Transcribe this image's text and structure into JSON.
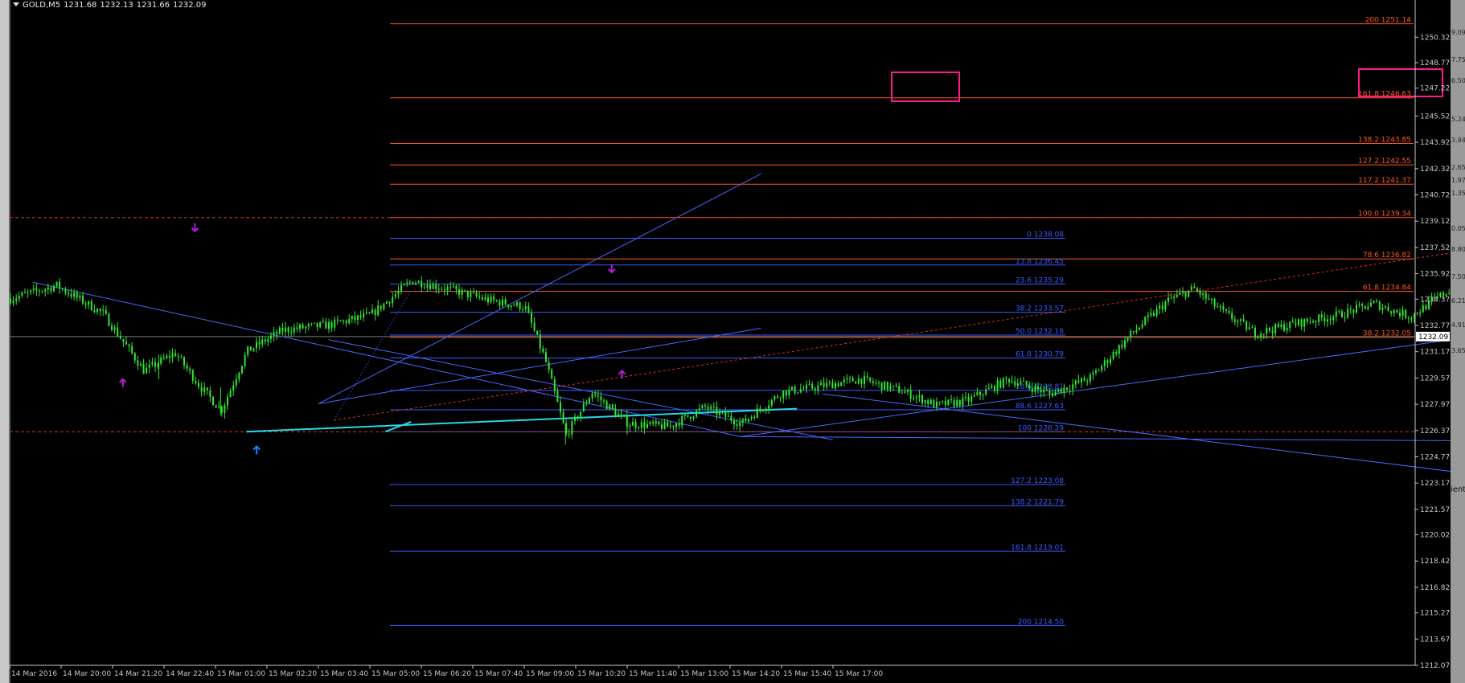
{
  "header": {
    "symbol": "GOLD,M5",
    "open": "1231.68",
    "high": "1232.13",
    "low": "1231.66",
    "close": "1232.09"
  },
  "colors": {
    "background": "#000000",
    "candle": "#2fe82f",
    "fib_red": "#ff5a1f",
    "fib_blue": "#3a5bff",
    "trend_blue": "#4868ff",
    "support_cyan": "#28d8e8",
    "dashed_red": "#e03020",
    "arrow_purple": "#b020e0",
    "arrow_blue": "#2080ff",
    "highlight_magenta": "#ff1a8c",
    "axis_text": "#c8c8c8"
  },
  "chart_data": {
    "type": "candlestick",
    "title": "GOLD,M5",
    "timeframe": "M5",
    "ylim": [
      1212.07,
      1252.0
    ],
    "price_ticks": [
      "1250.32",
      "1248.77",
      "1247.22",
      "1245.52",
      "1243.92",
      "1242.32",
      "1240.72",
      "1239.12",
      "1237.52",
      "1235.92",
      "1234.37",
      "1232.77",
      "1231.17",
      "1229.57",
      "1227.97",
      "1226.37",
      "1224.77",
      "1223.17",
      "1221.57",
      "1220.02",
      "1218.42",
      "1216.82",
      "1215.27",
      "1213.67",
      "1212.07"
    ],
    "time_ticks": [
      "14 Mar 2016",
      "14 Mar 20:00",
      "14 Mar 21:20",
      "14 Mar 22:40",
      "15 Mar 01:00",
      "15 Mar 02:20",
      "15 Mar 03:40",
      "15 Mar 05:00",
      "15 Mar 06:20",
      "15 Mar 07:40",
      "15 Mar 09:00",
      "15 Mar 10:20",
      "15 Mar 11:40",
      "15 Mar 13:00",
      "15 Mar 14:20",
      "15 Mar 15:40",
      "15 Mar 17:00"
    ],
    "current_price": "1232.09",
    "price_anchors": [
      [
        0,
        1234.4
      ],
      [
        0.9,
        1235.2
      ],
      [
        1.8,
        1233.5
      ],
      [
        2.6,
        1230.0
      ],
      [
        3.2,
        1231.1
      ],
      [
        3.7,
        1229.0
      ],
      [
        4.1,
        1227.6
      ],
      [
        4.6,
        1231.2
      ],
      [
        5.3,
        1232.5
      ],
      [
        6.2,
        1232.8
      ],
      [
        7.0,
        1233.4
      ],
      [
        7.8,
        1235.5
      ],
      [
        8.5,
        1235.0
      ],
      [
        9.3,
        1234.3
      ],
      [
        10.0,
        1233.9
      ],
      [
        10.4,
        1230.6
      ],
      [
        10.8,
        1226.1
      ],
      [
        11.3,
        1228.7
      ],
      [
        12.0,
        1226.8
      ],
      [
        12.8,
        1226.6
      ],
      [
        13.5,
        1227.8
      ],
      [
        14.2,
        1226.8
      ],
      [
        15.0,
        1228.7
      ],
      [
        15.8,
        1229.1
      ],
      [
        16.5,
        1229.5
      ],
      [
        17.3,
        1228.8
      ],
      [
        18.0,
        1227.9
      ],
      [
        18.6,
        1228.2
      ],
      [
        19.4,
        1229.5
      ],
      [
        20.2,
        1228.6
      ],
      [
        21.0,
        1229.6
      ],
      [
        21.8,
        1232.3
      ],
      [
        22.5,
        1234.3
      ],
      [
        23.0,
        1235.0
      ],
      [
        23.6,
        1233.5
      ],
      [
        24.2,
        1232.3
      ],
      [
        25.0,
        1232.9
      ],
      [
        25.8,
        1233.4
      ],
      [
        26.5,
        1234.1
      ],
      [
        27.2,
        1233.3
      ],
      [
        27.8,
        1234.6
      ],
      [
        28.4,
        1235.8
      ],
      [
        29.0,
        1233.8
      ],
      [
        29.6,
        1231.5
      ],
      [
        30.1,
        1230.8
      ],
      [
        30.7,
        1234.8
      ],
      [
        31.2,
        1237.6
      ],
      [
        31.8,
        1235.2
      ],
      [
        32.3,
        1233.6
      ],
      [
        32.9,
        1232.1
      ],
      [
        33.4,
        1230.3
      ],
      [
        34.0,
        1232.5
      ],
      [
        34.6,
        1231.1
      ],
      [
        35.3,
        1232.8
      ],
      [
        35.8,
        1231.7
      ],
      [
        36.3,
        1229.7
      ],
      [
        36.7,
        1228.8
      ],
      [
        37.0,
        1230.6
      ],
      [
        37.4,
        1232.2
      ]
    ],
    "fibonacci_red": [
      {
        "label": "200",
        "value": "1251.14"
      },
      {
        "label": "161.8",
        "value": "1246.63"
      },
      {
        "label": "138.2",
        "value": "1243.85"
      },
      {
        "label": "127.2",
        "value": "1242.55"
      },
      {
        "label": "117.2",
        "value": "1241.37"
      },
      {
        "label": "100.0",
        "value": "1239.34"
      },
      {
        "label": "78.6",
        "value": "1236.82"
      },
      {
        "label": "61.8",
        "value": "1234.84"
      },
      {
        "label": "38.2",
        "value": "1232.05"
      }
    ],
    "fibonacci_blue": [
      {
        "label": "0",
        "value": "1238.08"
      },
      {
        "label": "13.8",
        "value": "1236.45"
      },
      {
        "label": "23.6",
        "value": "1235.29"
      },
      {
        "label": "38.2",
        "value": "1233.57"
      },
      {
        "label": "50.0",
        "value": "1232.18"
      },
      {
        "label": "61.8",
        "value": "1230.79"
      },
      {
        "label": "78.6",
        "value": "1228.81"
      },
      {
        "label": "88.6",
        "value": "1227.63"
      },
      {
        "label": "100",
        "value": "1226.29"
      },
      {
        "label": "127.2",
        "value": "1223.08"
      },
      {
        "label": "138.2",
        "value": "1221.79"
      },
      {
        "label": "161.8",
        "value": "1219.01"
      },
      {
        "label": "200",
        "value": "1214.50"
      }
    ],
    "dashed_red_levels": [
      1239.34,
      1226.29
    ],
    "highlight_label": "161.8 1246.63",
    "right_edge_labels": [
      "9.09",
      "7.75",
      "6.50",
      "5.24",
      "3.94",
      "2.65",
      "1.97",
      "1.35",
      "0.05",
      "8.80",
      "7.50",
      "6.21",
      "4.91",
      "3.65"
    ],
    "right_edge_fragment": "ient"
  }
}
